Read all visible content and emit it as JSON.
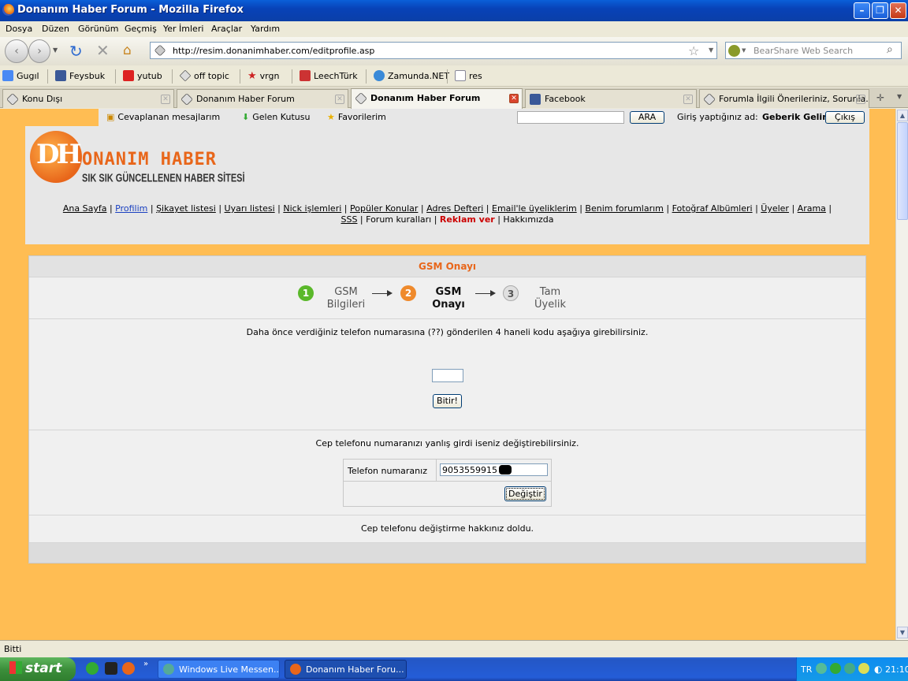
{
  "window": {
    "title": "Donanım Haber Forum - Mozilla Firefox"
  },
  "menu": [
    "Dosya",
    "Düzen",
    "Görünüm",
    "Geçmiş",
    "Yer İmleri",
    "Araçlar",
    "Yardım"
  ],
  "nav": {
    "url": "http://resim.donanimhaber.com/editprofile.asp",
    "search_placeholder": "BearShare Web Search"
  },
  "bookmarks": [
    "Gugıl",
    "Feysbuk",
    "yutub",
    "off topic",
    "vrgn",
    "LeechTürk",
    "Zamunda.NET",
    "res"
  ],
  "tabs": [
    "Konu Dışı",
    "Donanım Haber Forum",
    "Donanım Haber Forum",
    "Facebook",
    "Forumla İlgili Önerileriniz, Sorunla..."
  ],
  "site": {
    "toplinks": [
      "Cevaplanan mesajlarım",
      "Gelen Kutusu",
      "Favorilerim"
    ],
    "search_button": "ARA",
    "login_label": "Giriş yaptığınız ad:",
    "username": "Geberik Gelin",
    "logout": "Çıkış",
    "logo_title": "ONANIM HABER",
    "logo_sub": "SIK SIK GÜNCELLENEN HABER SİTESİ",
    "navlinks": [
      "Ana Sayfa",
      "Profilim",
      "Şikayet listesi",
      "Uyarı listesi",
      "Nick işlemleri",
      "Popüler Konular",
      "Adres Defteri",
      "Email'le üyeliklerim",
      "Benim forumlarım",
      "Fotoğraf Albümleri",
      "Üyeler",
      "Arama"
    ],
    "navlinks2": [
      "SSS",
      "Forum kuralları",
      "Reklam ver",
      "Hakkımızda"
    ]
  },
  "gsm": {
    "title": "GSM Onayı",
    "steps": [
      {
        "num": "1",
        "line1": "GSM",
        "line2": "Bilgileri"
      },
      {
        "num": "2",
        "line1": "GSM",
        "line2": "Onayı"
      },
      {
        "num": "3",
        "line1": "Tam",
        "line2": "Üyelik"
      }
    ],
    "instruction": "Daha önce verdiğiniz telefon numarasına (??) gönderilen 4 haneli kodu aşağıya girebilirsiniz.",
    "code_value": "",
    "finish_button": "Bitir!",
    "change_text": "Cep telefonu numaranızı yanlış girdi iseniz değiştirebilirsiniz.",
    "phone_label": "Telefon numaranız",
    "phone_value": "9053559915",
    "change_button": "Değiştir",
    "quota_text": "Cep telefonu değiştirme hakkınız doldu."
  },
  "status": {
    "text": "Bitti"
  },
  "taskbar": {
    "start": "start",
    "tasks": [
      "Windows Live Messen...",
      "Donanım Haber Foru..."
    ],
    "lang": "TR",
    "clock": "21:10"
  },
  "colors": {
    "page_bg": "#ffbd53",
    "title_orange": "#e8661a",
    "step1": "#5ab82a",
    "step2": "#ef8a2c",
    "step3": "#9a9a9a"
  }
}
